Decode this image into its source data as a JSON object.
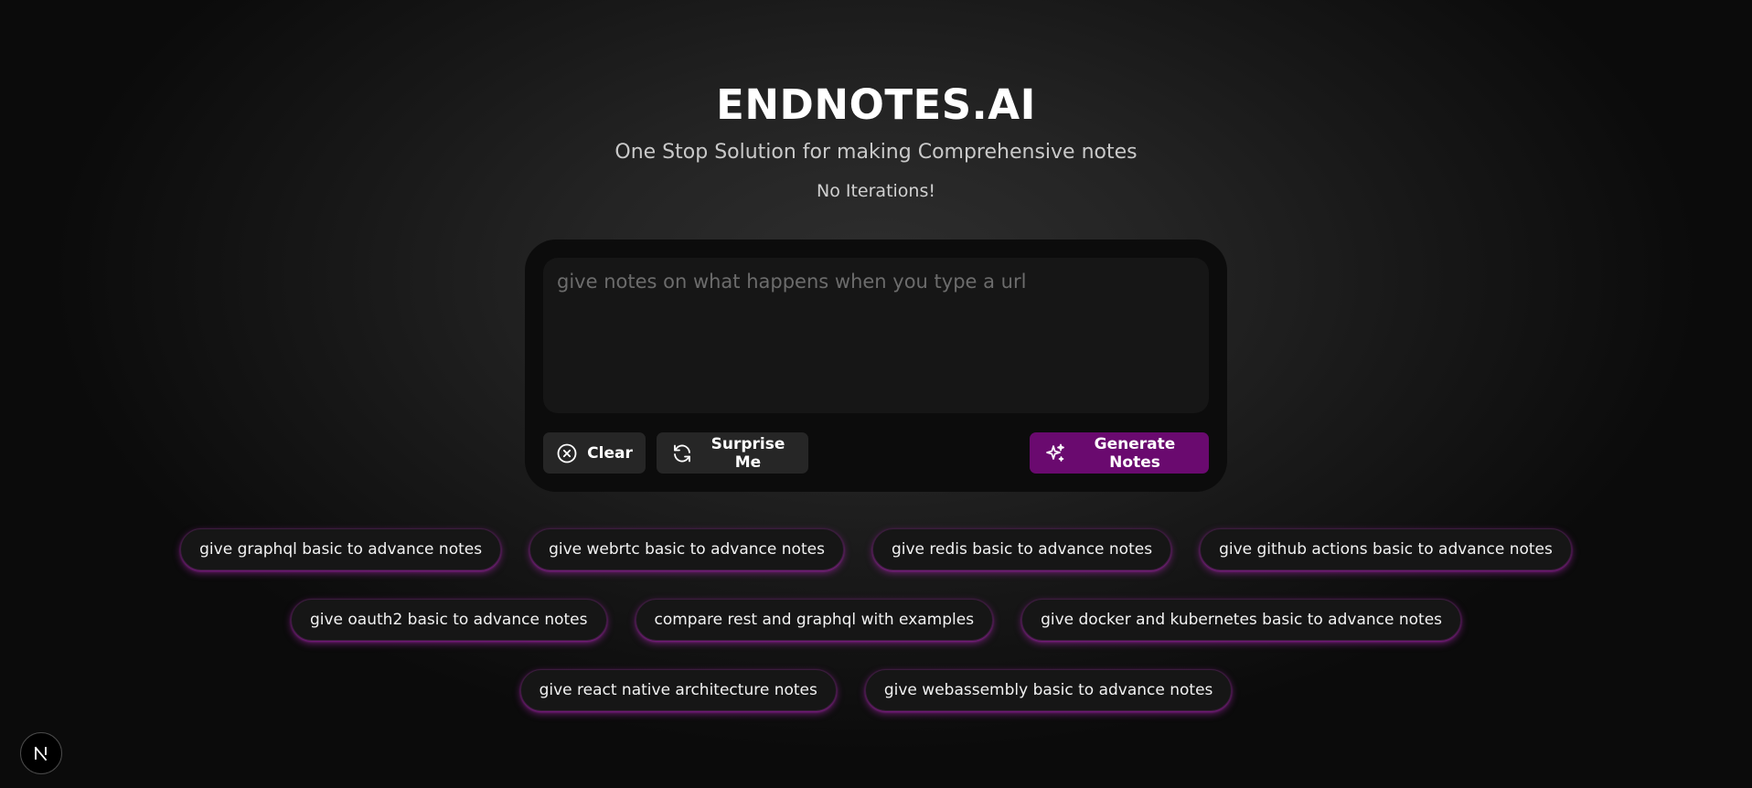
{
  "header": {
    "title": "ENDNOTES.AI",
    "subtitle": "One Stop Solution for making Comprehensive notes",
    "tagline": "No Iterations!"
  },
  "composer": {
    "placeholder": "give notes on what happens when you type a url",
    "value": "",
    "clear_label": "Clear",
    "clear_icon": "x-circle-icon",
    "surprise_label": "Surprise Me",
    "surprise_icon": "refresh-icon",
    "generate_label": "Generate Notes",
    "generate_icon": "sparkles-icon"
  },
  "suggestions": {
    "rows": [
      [
        "give graphql basic to advance notes",
        "give webrtc basic to advance notes",
        "give redis basic to advance notes",
        "give github actions basic to advance notes"
      ],
      [
        "give oauth2 basic to advance notes",
        "compare rest and graphql with examples",
        "give docker and kubernetes basic to advance notes"
      ],
      [
        "give react native architecture notes",
        "give webassembly basic to advance notes"
      ]
    ]
  },
  "dev_badge": {
    "icon": "nextjs-logo-icon"
  },
  "colors": {
    "background": "#1f1f1f",
    "panel": "#0c0c0c",
    "input": "#161616",
    "button": "#262626",
    "accent": "#6a0a6f",
    "chip_glow": "#aa28af"
  }
}
